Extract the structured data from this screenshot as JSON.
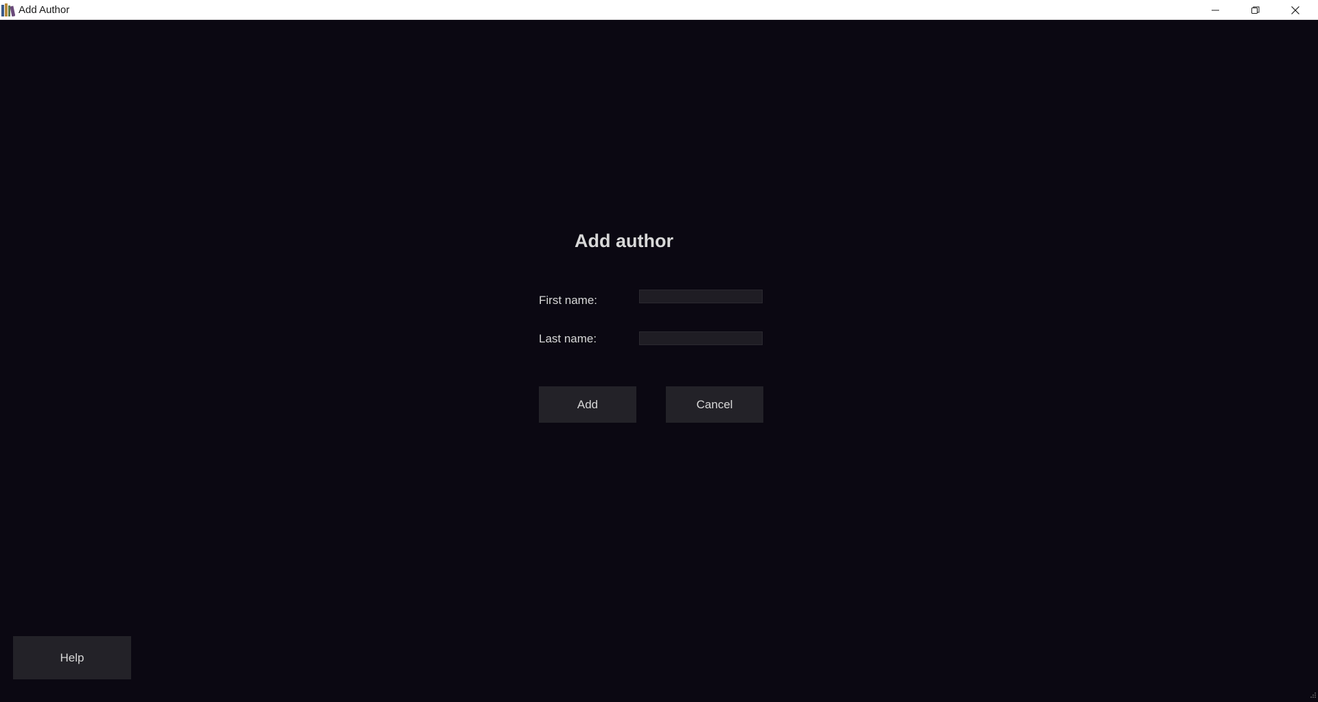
{
  "window": {
    "title": "Add Author",
    "icon": "books-icon",
    "controls": [
      "minimize-icon",
      "restore-icon",
      "close-icon"
    ]
  },
  "form": {
    "heading": "Add author",
    "first_name_label": "First name:",
    "first_name_value": "",
    "last_name_label": "Last name:",
    "last_name_value": ""
  },
  "actions": {
    "add_label": "Add",
    "cancel_label": "Cancel",
    "help_label": "Help"
  },
  "colors": {
    "background": "#0b0812",
    "button": "#232228",
    "input": "#1f1d24",
    "text": "#d8d8d8"
  }
}
